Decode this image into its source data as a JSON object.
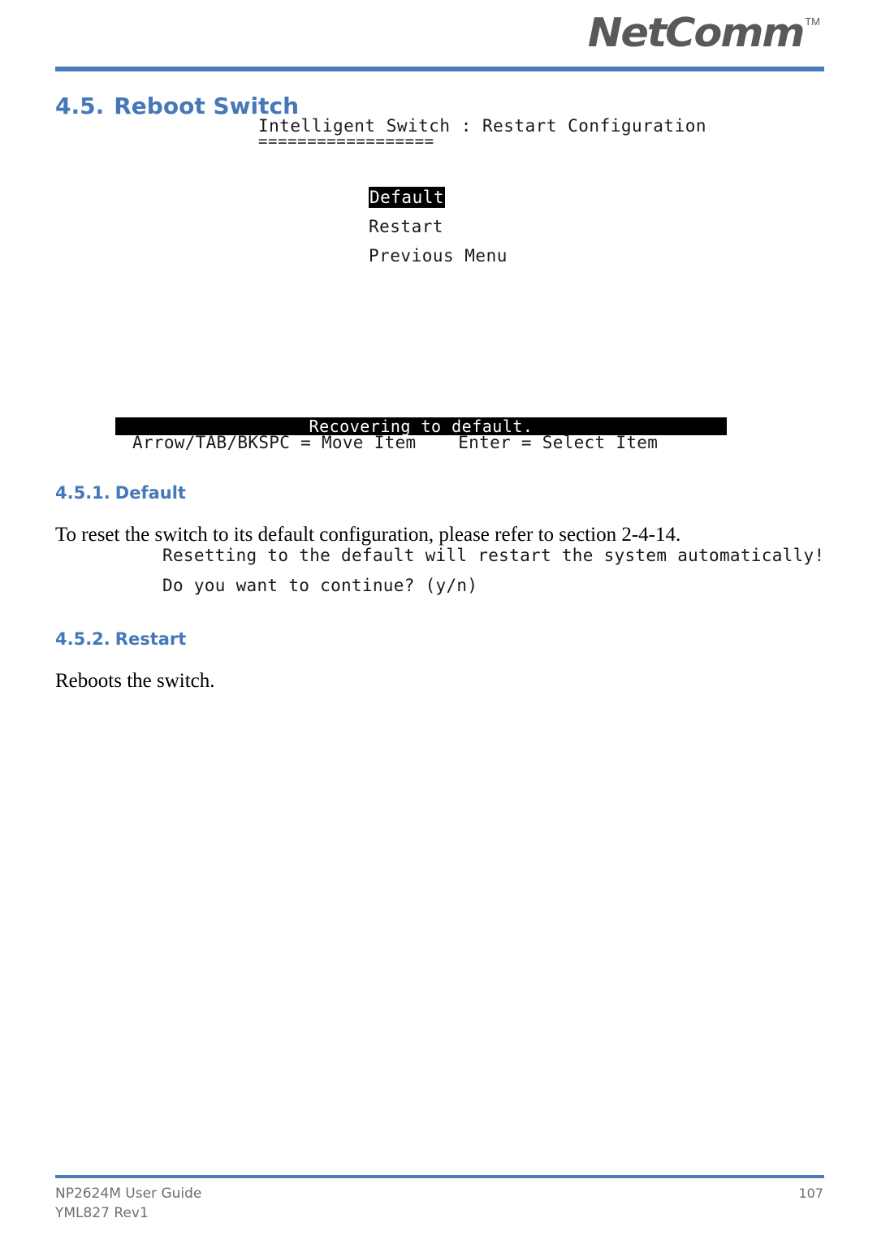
{
  "header": {
    "logo_text": "NetComm",
    "logo_trademark": "TM",
    "accent_color": "#4a7ebb",
    "logo_color": "#58595b"
  },
  "section": {
    "number": "4.5.",
    "title": "Reboot Switch"
  },
  "console_menu": {
    "title": "Intelligent Switch : Restart Configuration",
    "title_underline": "==================",
    "items": [
      {
        "label": "Default",
        "selected": true
      },
      {
        "label": "Restart",
        "selected": false
      },
      {
        "label": "Previous Menu",
        "selected": false
      }
    ],
    "status_message": "Recovering to default.",
    "help_line": "Arrow/TAB/BKSPC = Move Item    Enter = Select Item"
  },
  "subsections": [
    {
      "number": "4.5.1.",
      "title": "Default",
      "body": "To reset the switch to its default configuration, please refer to section 2-4-14."
    },
    {
      "number": "4.5.2.",
      "title": "Restart",
      "body": "Reboots the switch."
    }
  ],
  "console_prompt": {
    "line1": "Resetting to the default will restart the system automatically!",
    "line2": "Do you want to continue? (y/n)"
  },
  "footer": {
    "guide": "NP2624M User Guide",
    "revision": "YML827 Rev1",
    "page_number": "107"
  }
}
